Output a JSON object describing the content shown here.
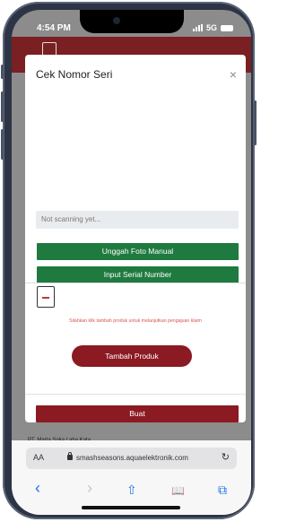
{
  "status_bar": {
    "time": "4:54 PM",
    "network": "5G"
  },
  "modal": {
    "title": "Cek Nomor Seri",
    "close_glyph": "×",
    "scan_status": "Not scanning yet...",
    "upload_label": "Unggah Foto Manual",
    "serial_label": "Input Serial Number",
    "hint": "Silahkan klik tambah produk untuk melanjutkan pengajuan klaim",
    "add_product_label": "Tambah Produk",
    "submit_label": "Buat"
  },
  "background": {
    "partial_text": "PT. Marta Soka Laba Kata"
  },
  "browser": {
    "aa_label": "AA",
    "url": "smashseasons.aquaelektronik.com",
    "reload_glyph": "↻",
    "toolbar": {
      "back": "‹",
      "forward": "›",
      "share": "⇧",
      "bookmarks": "📖",
      "tabs": "⧉"
    }
  }
}
